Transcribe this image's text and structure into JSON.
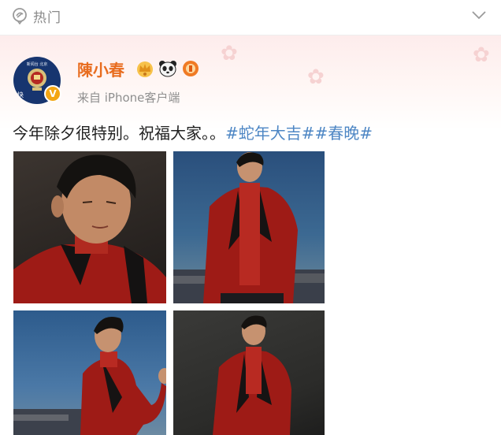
{
  "topbar": {
    "hot_label": "热门",
    "hot_icon": "location-pin-icon",
    "expand_icon": "chevron-down-icon"
  },
  "post": {
    "username": "陳小春",
    "badges": [
      "crown-badge-icon",
      "panda-badge-icon",
      "orange-badge-icon"
    ],
    "source": "来自 iPhone客户端",
    "avatar": {
      "top_text": "新闻台 北京",
      "tag": "快"
    },
    "verified_mark": "V",
    "text": "今年除夕很特别。祝福大家。。",
    "hashtags": [
      "#蛇年大吉#",
      "#春晚#"
    ],
    "images": [
      {
        "name": "photo-portrait-closeup"
      },
      {
        "name": "photo-red-suit-standing"
      },
      {
        "name": "photo-red-suit-pose"
      },
      {
        "name": "photo-red-suit-dark"
      }
    ]
  },
  "colors": {
    "username": "#e86c1e",
    "hashtag": "#4d86c4",
    "verified": "#f3a614",
    "suit_red": "#9e1b16"
  }
}
